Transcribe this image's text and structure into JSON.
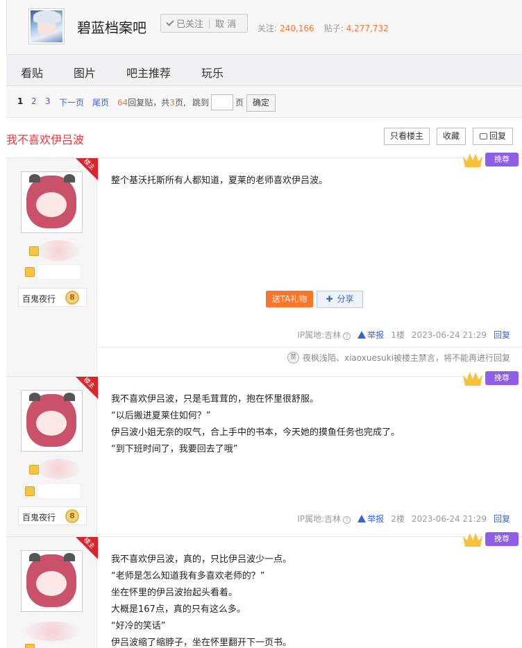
{
  "forum": {
    "name": "碧蓝档案吧",
    "followed_label": "已关注",
    "unfollow_label": "取 消",
    "followers_label": "关注:",
    "followers": "240,166",
    "posts_label": "贴子:",
    "posts": "4,277,732"
  },
  "nav": [
    "看贴",
    "图片",
    "吧主推荐",
    "玩乐"
  ],
  "pager": {
    "pages": [
      "1",
      "2",
      "3"
    ],
    "next": "下一页",
    "last": "尾页",
    "reply_count": "64",
    "reply_suffix": "回复贴，共",
    "total_pages": "3",
    "pages_suffix": "页,",
    "jump_label": "跳到",
    "page_unit": "页",
    "confirm": "确定"
  },
  "thread": {
    "title": "我不喜欢伊吕波",
    "only_op": "只看楼主",
    "favorite": "收藏",
    "reply": "回复"
  },
  "common": {
    "louzhu": "楼主",
    "wanzun": "挽尊",
    "user_title": "百鬼夜行",
    "level": "8",
    "ip": "IP属地:吉林",
    "report": "举报",
    "reply": "回复",
    "gift": "送TA礼物",
    "share": "分享"
  },
  "posts": [
    {
      "lines": [
        "整个基沃托斯所有人都知道，夏莱的老师喜欢伊吕波。"
      ],
      "floor": "1楼",
      "time": "2023-06-24 21:29",
      "ban_note": "夜枫浅陌、xiaoxuesuki被楼主禁言，将不能再进行回复"
    },
    {
      "lines": [
        "我不喜欢伊吕波，只是毛茸茸的，抱在怀里很舒服。",
        "“以后搬进夏莱住如何？”",
        "伊吕波小姐无奈的叹气，合上手中的书本，今天她的摸鱼任务也完成了。",
        "“到下班时间了，我要回去了哦”"
      ],
      "floor": "2楼",
      "time": "2023-06-24 21:29"
    },
    {
      "lines": [
        "我不喜欢伊吕波，真的，只比伊吕波少一点。",
        "“老师是怎么知道我有多喜欢老师的？”",
        "坐在怀里的伊吕波抬起头看着。",
        "大概是167点，真的只有这么多。",
        "“好冷的笑话”",
        "伊吕波缩了缩脖子，坐在怀里翻开下一页书。"
      ]
    }
  ]
}
